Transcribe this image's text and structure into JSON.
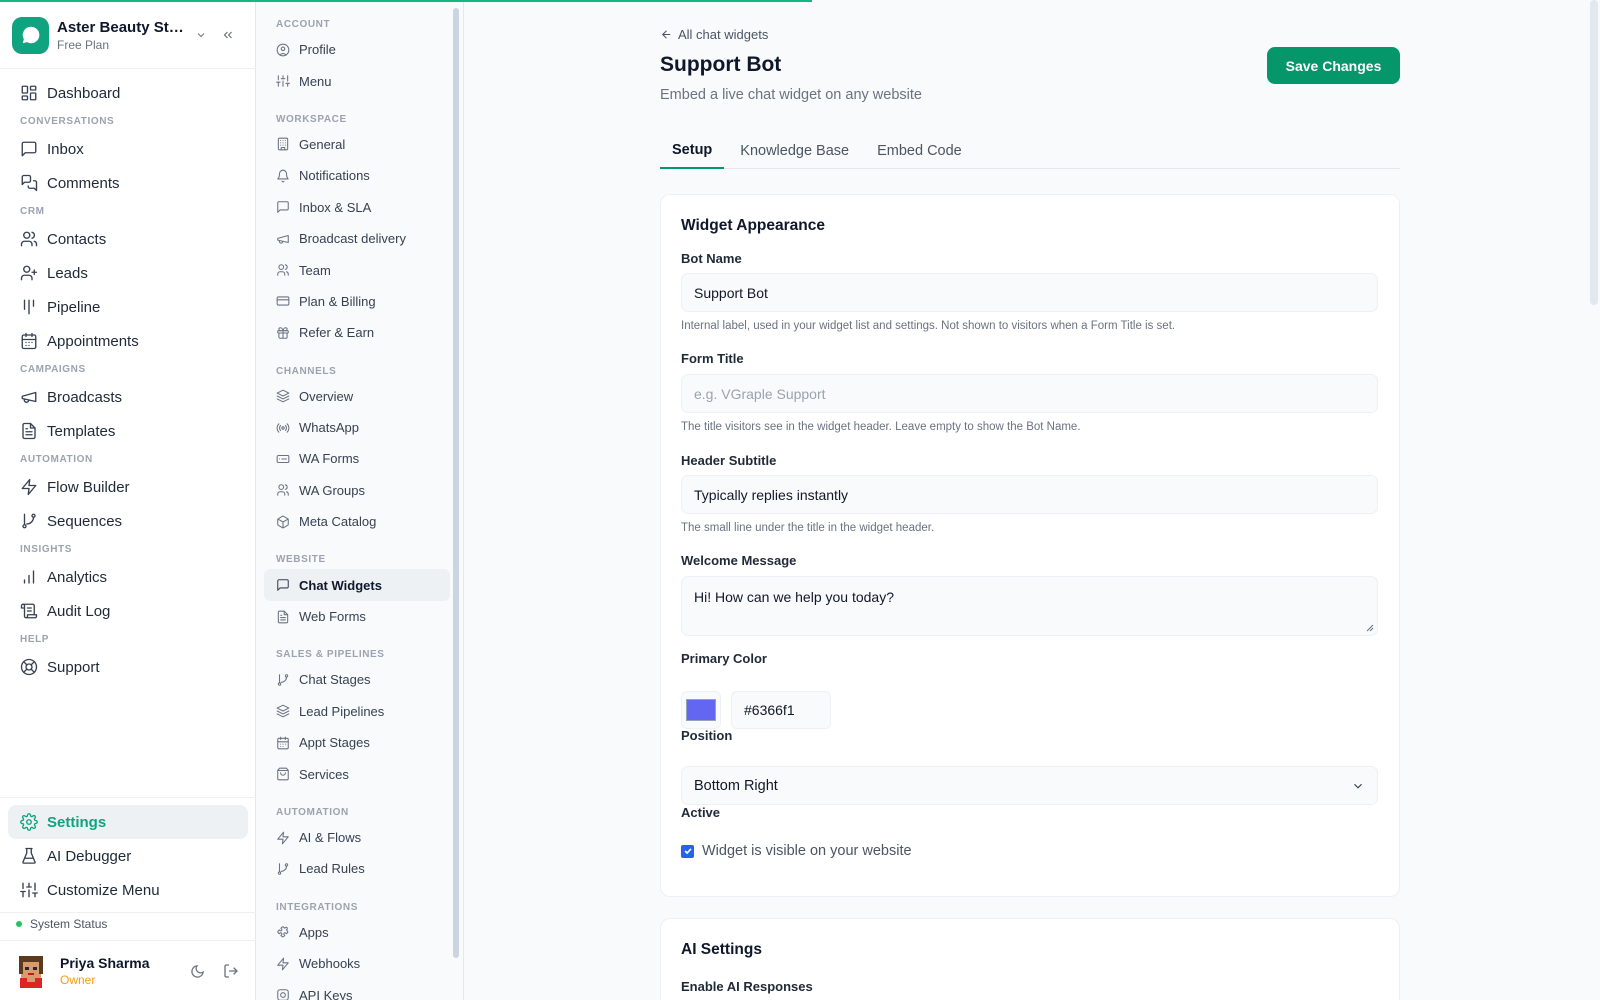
{
  "workspace": {
    "name": "Aster Beauty Stu...",
    "plan": "Free Plan"
  },
  "primary_nav": [
    {
      "type": "item",
      "label": "Dashboard",
      "icon": "dashboard-icon"
    },
    {
      "type": "section",
      "label": "CONVERSATIONS"
    },
    {
      "type": "item",
      "label": "Inbox",
      "icon": "inbox-icon"
    },
    {
      "type": "item",
      "label": "Comments",
      "icon": "comments-icon"
    },
    {
      "type": "section",
      "label": "CRM"
    },
    {
      "type": "item",
      "label": "Contacts",
      "icon": "contacts-icon"
    },
    {
      "type": "item",
      "label": "Leads",
      "icon": "leads-icon"
    },
    {
      "type": "item",
      "label": "Pipeline",
      "icon": "pipeline-icon"
    },
    {
      "type": "item",
      "label": "Appointments",
      "icon": "calendar-icon"
    },
    {
      "type": "section",
      "label": "CAMPAIGNS"
    },
    {
      "type": "item",
      "label": "Broadcasts",
      "icon": "megaphone-icon"
    },
    {
      "type": "item",
      "label": "Templates",
      "icon": "file-icon"
    },
    {
      "type": "section",
      "label": "AUTOMATION"
    },
    {
      "type": "item",
      "label": "Flow Builder",
      "icon": "bolt-icon"
    },
    {
      "type": "item",
      "label": "Sequences",
      "icon": "branch-icon"
    },
    {
      "type": "section",
      "label": "INSIGHTS"
    },
    {
      "type": "item",
      "label": "Analytics",
      "icon": "bar-chart-icon"
    },
    {
      "type": "item",
      "label": "Audit Log",
      "icon": "scroll-icon"
    },
    {
      "type": "section",
      "label": "HELP"
    },
    {
      "type": "item",
      "label": "Support",
      "icon": "lifebuoy-icon"
    }
  ],
  "bottom_nav": [
    {
      "label": "Settings",
      "icon": "gear-icon",
      "active": true
    },
    {
      "label": "AI Debugger",
      "icon": "flask-icon",
      "active": false
    },
    {
      "label": "Customize Menu",
      "icon": "sliders-icon",
      "active": false
    }
  ],
  "system_status": "System Status",
  "user": {
    "name": "Priya Sharma",
    "role": "Owner"
  },
  "settings_nav": [
    {
      "type": "section",
      "label": "ACCOUNT"
    },
    {
      "type": "item",
      "label": "Profile",
      "icon": "user-circle-icon"
    },
    {
      "type": "item",
      "label": "Menu",
      "icon": "sliders-icon"
    },
    {
      "type": "section",
      "label": "WORKSPACE"
    },
    {
      "type": "item",
      "label": "General",
      "icon": "building-icon"
    },
    {
      "type": "item",
      "label": "Notifications",
      "icon": "bell-icon"
    },
    {
      "type": "item",
      "label": "Inbox & SLA",
      "icon": "inbox-icon"
    },
    {
      "type": "item",
      "label": "Broadcast delivery",
      "icon": "megaphone-icon"
    },
    {
      "type": "item",
      "label": "Team",
      "icon": "team-icon"
    },
    {
      "type": "item",
      "label": "Plan & Billing",
      "icon": "credit-card-icon"
    },
    {
      "type": "item",
      "label": "Refer & Earn",
      "icon": "gift-icon"
    },
    {
      "type": "section",
      "label": "CHANNELS"
    },
    {
      "type": "item",
      "label": "Overview",
      "icon": "layers-icon"
    },
    {
      "type": "item",
      "label": "WhatsApp",
      "icon": "radio-icon"
    },
    {
      "type": "item",
      "label": "WA Forms",
      "icon": "form-icon"
    },
    {
      "type": "item",
      "label": "WA Groups",
      "icon": "team-icon"
    },
    {
      "type": "item",
      "label": "Meta Catalog",
      "icon": "package-icon"
    },
    {
      "type": "section",
      "label": "WEBSITE"
    },
    {
      "type": "item",
      "label": "Chat Widgets",
      "icon": "chat-icon",
      "active": true
    },
    {
      "type": "item",
      "label": "Web Forms",
      "icon": "file-icon"
    },
    {
      "type": "section",
      "label": "SALES & PIPELINES"
    },
    {
      "type": "item",
      "label": "Chat Stages",
      "icon": "branch-icon"
    },
    {
      "type": "item",
      "label": "Lead Pipelines",
      "icon": "layers-icon"
    },
    {
      "type": "item",
      "label": "Appt Stages",
      "icon": "calendar-icon"
    },
    {
      "type": "item",
      "label": "Services",
      "icon": "bag-icon"
    },
    {
      "type": "section",
      "label": "AUTOMATION"
    },
    {
      "type": "item",
      "label": "AI & Flows",
      "icon": "bolt-icon"
    },
    {
      "type": "item",
      "label": "Lead Rules",
      "icon": "branch-icon"
    },
    {
      "type": "section",
      "label": "INTEGRATIONS"
    },
    {
      "type": "item",
      "label": "Apps",
      "icon": "puzzle-icon"
    },
    {
      "type": "item",
      "label": "Webhooks",
      "icon": "bolt-icon"
    },
    {
      "type": "item",
      "label": "API Keys",
      "icon": "key-icon"
    }
  ],
  "page": {
    "back_label": "All chat widgets",
    "title": "Support Bot",
    "subtitle": "Embed a live chat widget on any website",
    "save_label": "Save Changes",
    "tabs": [
      {
        "label": "Setup",
        "active": true
      },
      {
        "label": "Knowledge Base",
        "active": false
      },
      {
        "label": "Embed Code",
        "active": false
      }
    ]
  },
  "form": {
    "section_title": "Widget Appearance",
    "bot_name": {
      "label": "Bot Name",
      "value": "Support Bot",
      "help": "Internal label, used in your widget list and settings. Not shown to visitors when a Form Title is set."
    },
    "form_title": {
      "label": "Form Title",
      "value": "",
      "placeholder": "e.g. VGraple Support",
      "help": "The title visitors see in the widget header. Leave empty to show the Bot Name."
    },
    "header_subtitle": {
      "label": "Header Subtitle",
      "value": "Typically replies instantly",
      "help": "The small line under the title in the widget header."
    },
    "welcome_message": {
      "label": "Welcome Message",
      "value": "Hi! How can we help you today?"
    },
    "primary_color": {
      "label": "Primary Color",
      "value": "#6366f1"
    },
    "position": {
      "label": "Position",
      "value": "Bottom Right"
    },
    "active": {
      "label": "Active",
      "checkbox_label": "Widget is visible on your website",
      "checked": true
    }
  },
  "ai_settings": {
    "title": "AI Settings",
    "enable_label": "Enable AI Responses"
  },
  "colors": {
    "accent": "#059669",
    "brand": "#10a37f",
    "swatch": "#6366f1",
    "status_ok": "#22c55e"
  }
}
